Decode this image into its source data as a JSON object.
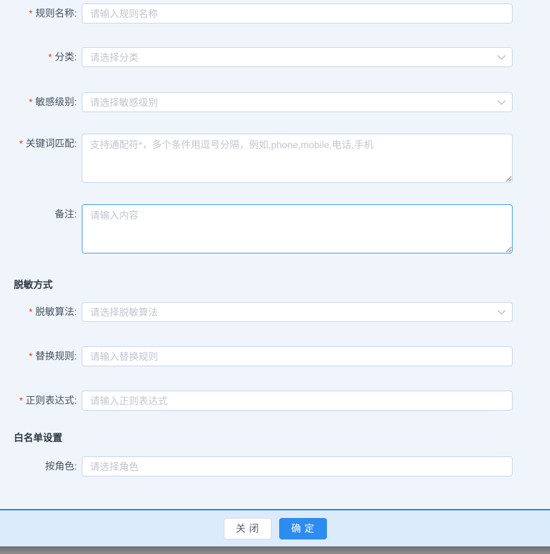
{
  "theme": {
    "page_background": "#f0f5fb",
    "footer_background": "#dcebfb",
    "divider_color": "#1f87e8",
    "primary_button_color": "#2d8cf0",
    "focused_border_color": "#3d9df2",
    "input_border_color": "#c4d7eb",
    "required_marker_color": "#ed3f14"
  },
  "form": {
    "required_marker": "*",
    "fields": {
      "rule_name": {
        "label": "规则名称:",
        "placeholder": "请输入规则名称"
      },
      "category": {
        "label": "分类:",
        "placeholder": "请选择分类"
      },
      "sensitivity_level": {
        "label": "敏感级别:",
        "placeholder": "请选择敏感级别"
      },
      "keyword_match": {
        "label": "关键词匹配:",
        "placeholder": "支持通配符*，多个条件用逗号分隔，例如,phone,mobile,电话,手机"
      },
      "remark": {
        "label": "备注:",
        "placeholder": "请输入内容"
      },
      "masking_algorithm": {
        "label": "脱敏算法:",
        "placeholder": "请选择脱敏算法"
      },
      "replacement_rule": {
        "label": "替换规则:",
        "placeholder": "请输入替换规则"
      },
      "regex": {
        "label": "正则表达式:",
        "placeholder": "请输入正则表达式"
      },
      "by_role": {
        "label": "按角色:",
        "placeholder": "请选择角色"
      }
    },
    "sections": {
      "masking_method": "脱敏方式",
      "whitelist_settings": "白名单设置"
    }
  },
  "footer": {
    "close_label": "关闭",
    "confirm_label": "确定"
  }
}
